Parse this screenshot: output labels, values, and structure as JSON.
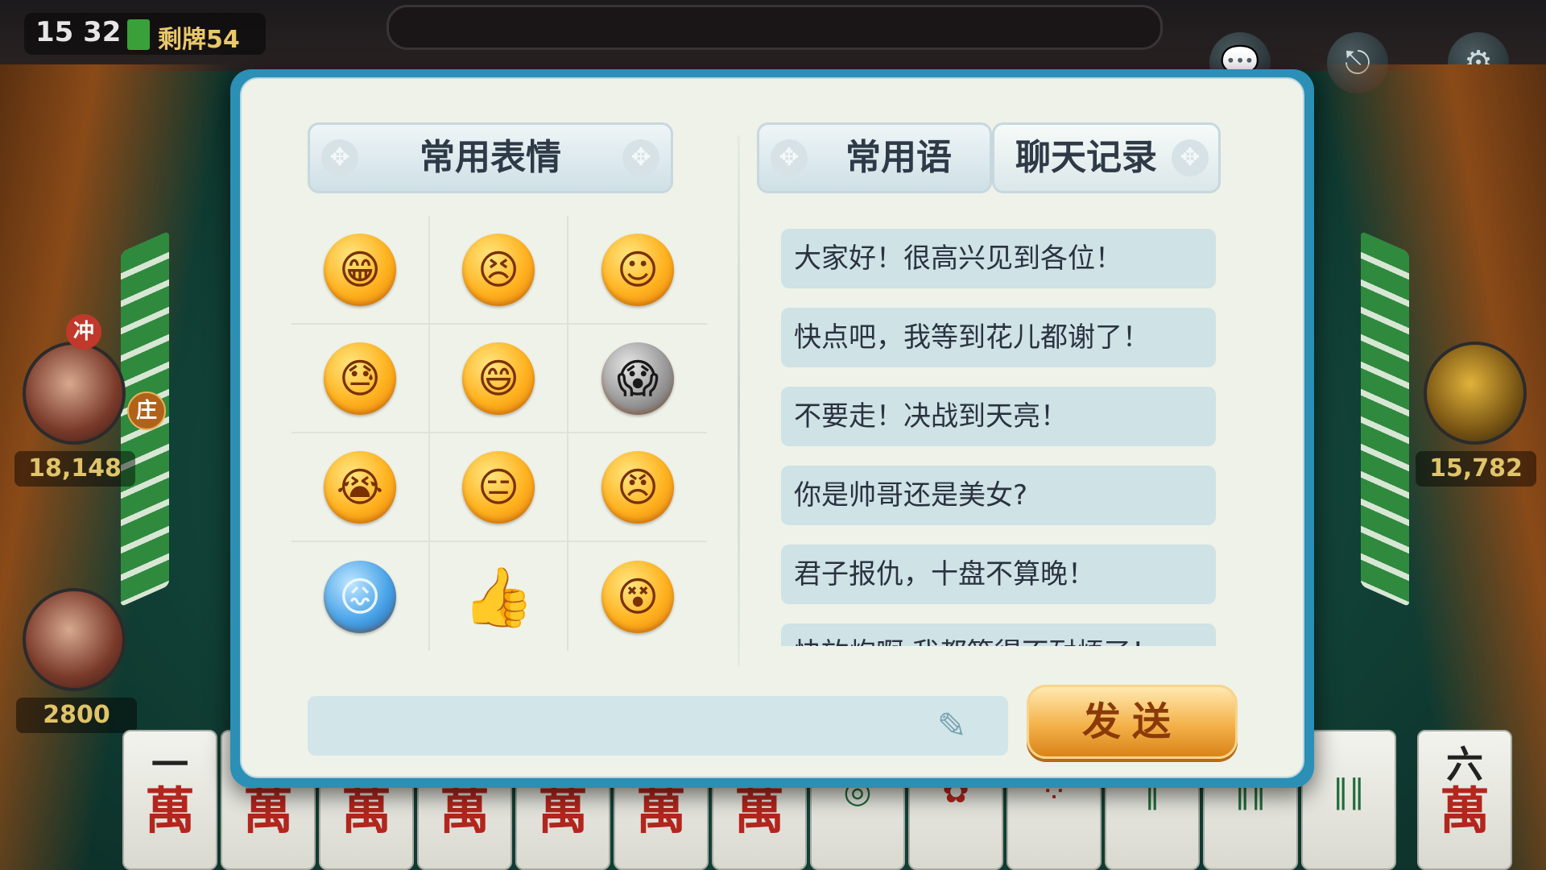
{
  "status": {
    "time": "15 32",
    "remaining_tiles": "剩牌54"
  },
  "toolbar": {
    "chat_icon": "chat-bubble-icon",
    "exit_icon": "exit-door-icon",
    "settings_icon": "gear-icon"
  },
  "players": {
    "left": {
      "score": "18,148",
      "badge_chong": "冲",
      "badge_zhuang": "庄"
    },
    "right": {
      "score": "15,782"
    },
    "self": {
      "score": "2800"
    }
  },
  "dialog": {
    "tabs": {
      "emotes": "常用表情",
      "phrases": "常用语",
      "history": "聊天记录"
    },
    "emotes": [
      "grin-face",
      "squint-face",
      "blush-smile-face",
      "sweat-face",
      "laugh-face",
      "scream-face",
      "cry-face",
      "meh-face",
      "angry-face",
      "freezing-face",
      "thumbs-up",
      "dizzy-face"
    ],
    "phrases": [
      "大家好！很高兴见到各位！",
      "快点吧，我等到花儿都谢了！",
      "不要走！决战到天亮！",
      "你是帅哥还是美女?",
      "君子报仇，十盘不算晚！",
      "快放炮啊,我都等得不耐烦了！"
    ],
    "input": {
      "value": "",
      "placeholder": ""
    },
    "send_label": "发送"
  },
  "hand_tiles": [
    "一萬",
    "萬",
    "萬",
    "萬",
    "萬",
    "萬",
    "萬",
    "筒",
    "筒",
    "筒",
    "条",
    "条",
    "条",
    "六萬"
  ],
  "colors": {
    "dialog_border": "#2b8fb6",
    "dialog_bg": "#eef2e9",
    "phrase_bg": "#cfe2e5",
    "send_button": "#f4b24a"
  }
}
